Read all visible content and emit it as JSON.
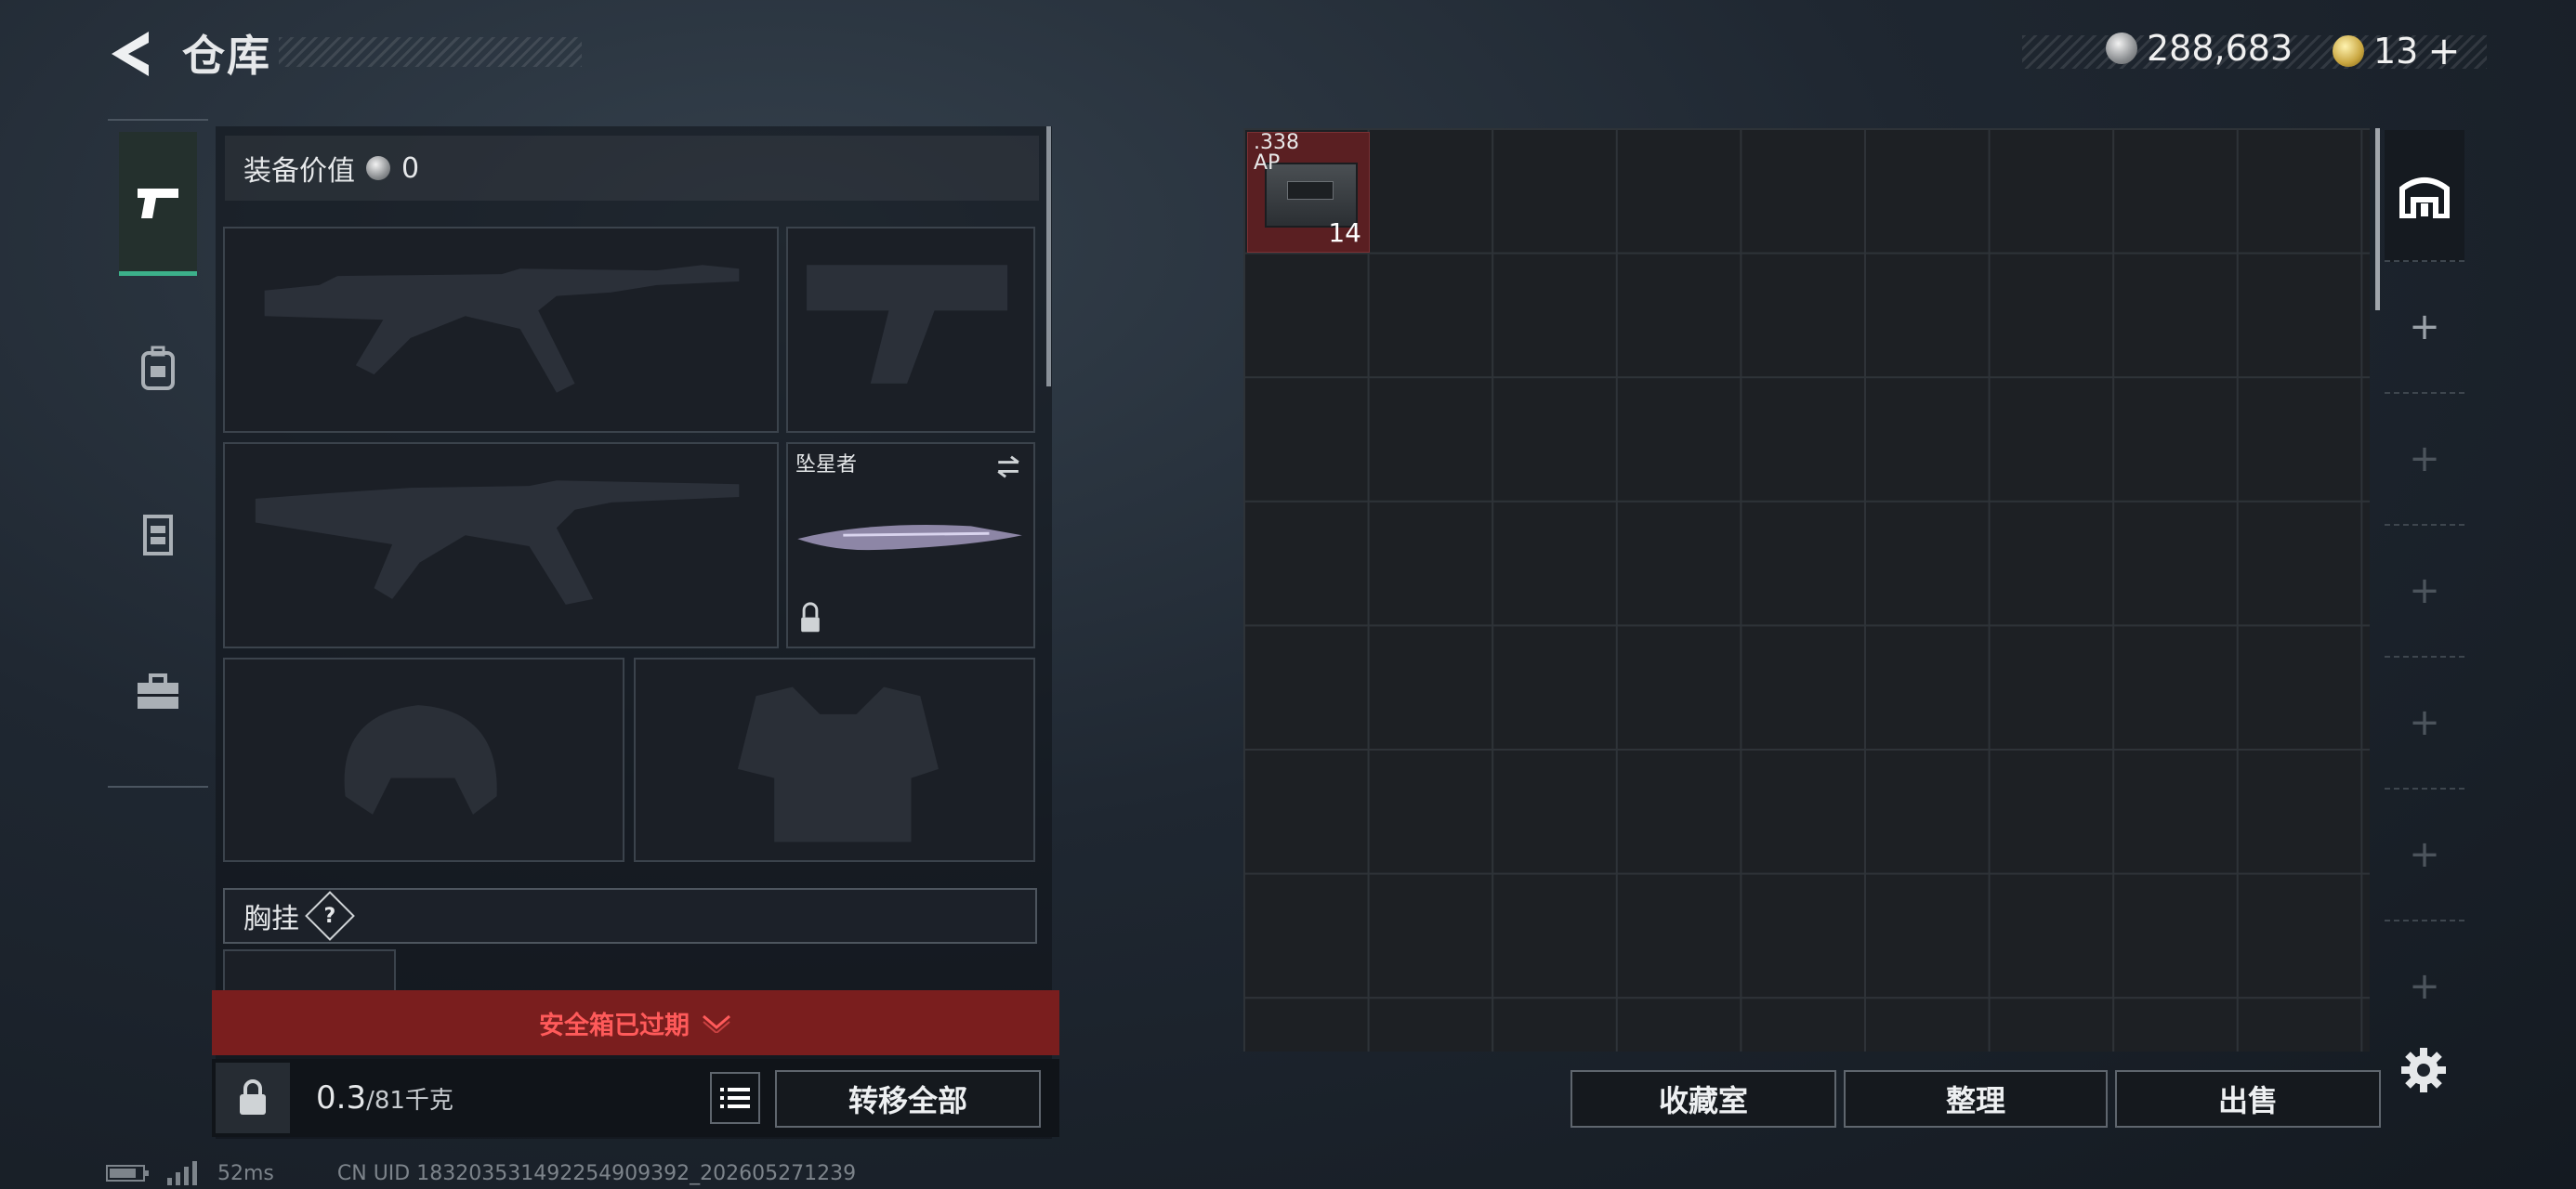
{
  "header": {
    "title": "仓库",
    "currency_silver": "288,683",
    "currency_gold": "13",
    "currency_gold_suffix": "+"
  },
  "left_tabs": [
    {
      "name": "weapons-tab-icon",
      "active": true
    },
    {
      "name": "backpack-tab-icon",
      "active": false
    },
    {
      "name": "rig-tab-icon",
      "active": false
    },
    {
      "name": "toolbox-tab-icon",
      "active": false
    }
  ],
  "equipment": {
    "value_label": "装备价值",
    "value": "0",
    "melee_name": "坠星者",
    "chest_label": "胸挂",
    "help": "?"
  },
  "safe_box": {
    "expired_text": "安全箱已过期"
  },
  "capacity": {
    "current": "0.3",
    "max": "/81",
    "unit": "千克"
  },
  "buttons": {
    "transfer_all": "转移全部",
    "collection": "收藏室",
    "sort": "整理",
    "sell": "出售"
  },
  "stash": {
    "item": {
      "label_line1": ".338",
      "label_line2": "AP",
      "quantity": "14"
    },
    "side_tabs": [
      "+",
      "+",
      "+",
      "+",
      "+",
      "+"
    ]
  },
  "footer": {
    "ping": "52ms",
    "uid": "CN UID 183203531492254909392_202605271239"
  }
}
